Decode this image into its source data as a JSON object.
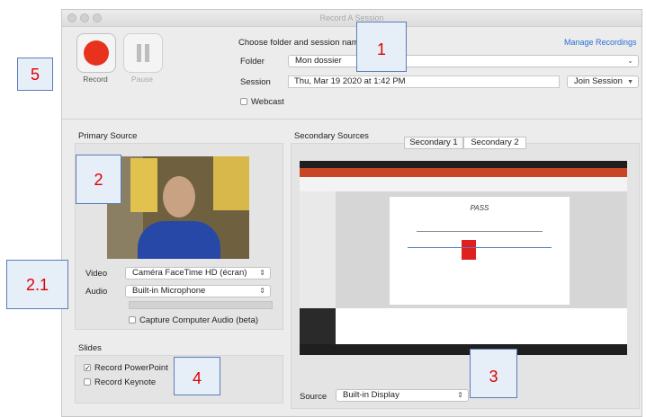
{
  "window": {
    "title": "Record A Session"
  },
  "session": {
    "header": "Choose folder and session name",
    "manage_link": "Manage Recordings",
    "folder_label": "Folder",
    "folder_value": "Mon dossier",
    "session_label": "Session",
    "session_value": "Thu, Mar 19 2020 at 1:42 PM",
    "join_label": "Join Session",
    "webcast_label": "Webcast"
  },
  "controls": {
    "record_label": "Record",
    "pause_label": "Pause"
  },
  "primary": {
    "title": "Primary Source",
    "video_label": "Video",
    "video_value": "Caméra FaceTime HD (écran)",
    "audio_label": "Audio",
    "audio_value": "Built-in Microphone",
    "capture_audio_label": "Capture Computer Audio (beta)"
  },
  "slides": {
    "title": "Slides",
    "powerpoint_label": "Record PowerPoint",
    "powerpoint_checked": true,
    "keynote_label": "Record Keynote"
  },
  "secondary": {
    "title": "Secondary Sources",
    "tabs": [
      "Secondary 1",
      "Secondary 2"
    ],
    "source_label": "Source",
    "source_value": "Built-in Display",
    "preview_slide_title": "PASS"
  },
  "callouts": [
    "5",
    "1",
    "2",
    "2.1",
    "3",
    "4"
  ],
  "colors": {
    "record": "#e8321e",
    "callout_text": "#e00000",
    "link": "#2a6fd6"
  }
}
